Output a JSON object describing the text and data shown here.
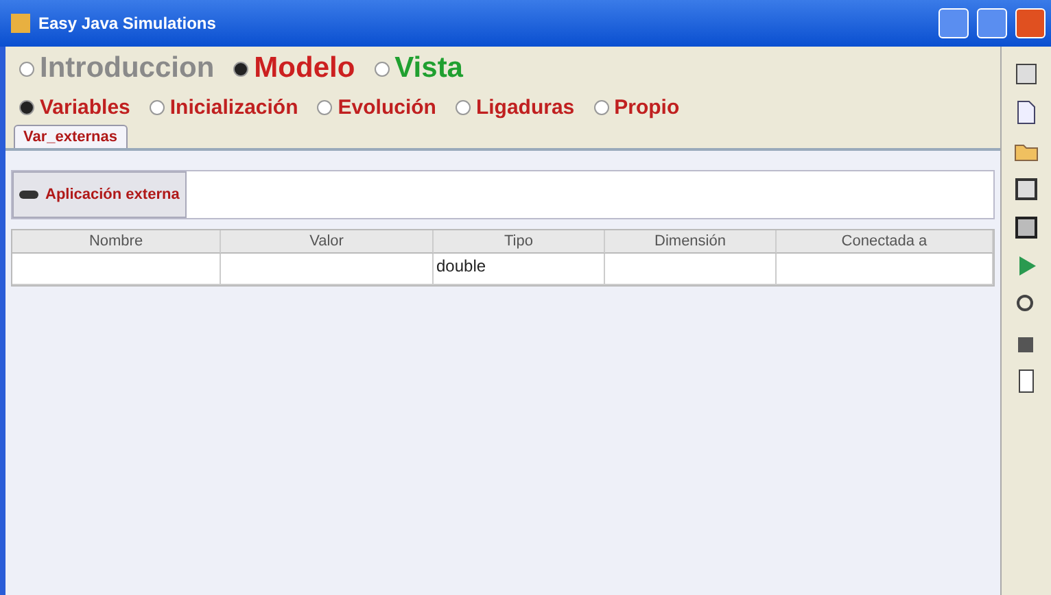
{
  "window": {
    "title": "Easy Java Simulations"
  },
  "main_tabs": [
    {
      "label": "Introduccion",
      "selected": false,
      "color": "#8a8a8a"
    },
    {
      "label": "Modelo",
      "selected": true,
      "color": "#cc2020"
    },
    {
      "label": "Vista",
      "selected": false,
      "color": "#20a030"
    }
  ],
  "sub_tabs": [
    {
      "label": "Variables",
      "selected": true
    },
    {
      "label": "Inicialización",
      "selected": false
    },
    {
      "label": "Evolución",
      "selected": false
    },
    {
      "label": "Ligaduras",
      "selected": false
    },
    {
      "label": "Propio",
      "selected": false
    }
  ],
  "page_tabs": [
    {
      "label": "Var_externas",
      "selected": true
    }
  ],
  "external_button": {
    "label": "Aplicación externa"
  },
  "table": {
    "columns": [
      "Nombre",
      "Valor",
      "Tipo",
      "Dimensión",
      "Conectada a"
    ],
    "rows": [
      [
        "",
        "",
        "double",
        "",
        ""
      ]
    ]
  }
}
